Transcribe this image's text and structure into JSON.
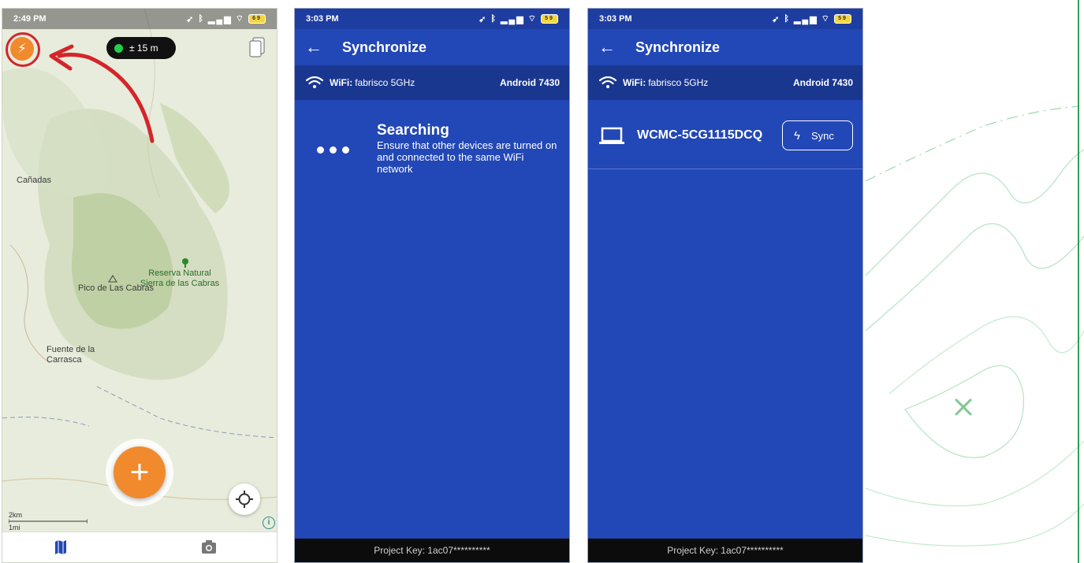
{
  "phone1": {
    "time": "2:49 PM",
    "battery": "69",
    "gps_accuracy": "± 15 m",
    "map_labels": {
      "canadas": "Cañadas",
      "reserva_1": "Reserva Natural",
      "reserva_2": "Sierra de las Cabras",
      "pico": "Pico de Las Cabras",
      "fuente_1": "Fuente de la",
      "fuente_2": "Carrasca"
    },
    "scale_km": "2km",
    "scale_mi": "1mi",
    "fab_symbol": "+",
    "info_symbol": "i"
  },
  "phone2": {
    "time": "3:03 PM",
    "battery": "59",
    "title": "Synchronize",
    "wifi_label": "WiFi:",
    "wifi_network": "fabrisco 5GHz",
    "device": "Android 7430",
    "searching_title": "Searching",
    "searching_message": "Ensure that other devices are turned on and connected to the same WiFi network",
    "project_key": "Project Key: 1ac07**********"
  },
  "phone3": {
    "time": "3:03 PM",
    "battery": "59",
    "title": "Synchronize",
    "wifi_label": "WiFi:",
    "wifi_network": "fabrisco 5GHz",
    "device": "Android 7430",
    "peer_device": "WCMC-5CG1115DCQ",
    "sync_label": "Sync",
    "project_key": "Project Key: 1ac07**********"
  },
  "colors": {
    "orange": "#f18a2d",
    "red_annotation": "#d3262b",
    "sync_blue": "#2247b6",
    "gps_green": "#21d04a"
  }
}
